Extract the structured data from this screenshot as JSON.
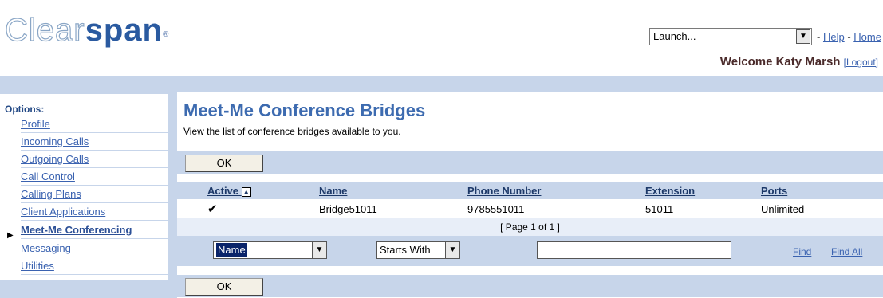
{
  "header": {
    "logo_light": "Clear",
    "logo_dark": "span",
    "logo_reg": "®",
    "launch_value": "Launch...",
    "links": {
      "sep": " - ",
      "help": "Help",
      "home": "Home"
    },
    "welcome": "Welcome Katy Marsh",
    "logout": "[Logout]"
  },
  "sidebar": {
    "title": "Options:",
    "items": [
      {
        "label": "Profile"
      },
      {
        "label": "Incoming Calls"
      },
      {
        "label": "Outgoing Calls"
      },
      {
        "label": "Call Control"
      },
      {
        "label": "Calling Plans"
      },
      {
        "label": "Client Applications"
      },
      {
        "label": "Meet-Me Conferencing",
        "active": true
      },
      {
        "label": "Messaging"
      },
      {
        "label": "Utilities"
      }
    ]
  },
  "main": {
    "title": "Meet-Me Conference Bridges",
    "description": "View the list of conference bridges available to you.",
    "ok_label": "OK",
    "columns": [
      "Active",
      "Name",
      "Phone Number",
      "Extension",
      "Ports"
    ],
    "rows": [
      {
        "active": "✔",
        "name": "Bridge51011",
        "phone": "9785551011",
        "extension": "51011",
        "ports": "Unlimited"
      }
    ],
    "pager": "[ Page 1 of 1 ]",
    "search": {
      "field_value": "Name",
      "condition_value": "Starts With",
      "text_value": "",
      "find_label": "Find",
      "find_all_label": "Find All"
    }
  }
}
